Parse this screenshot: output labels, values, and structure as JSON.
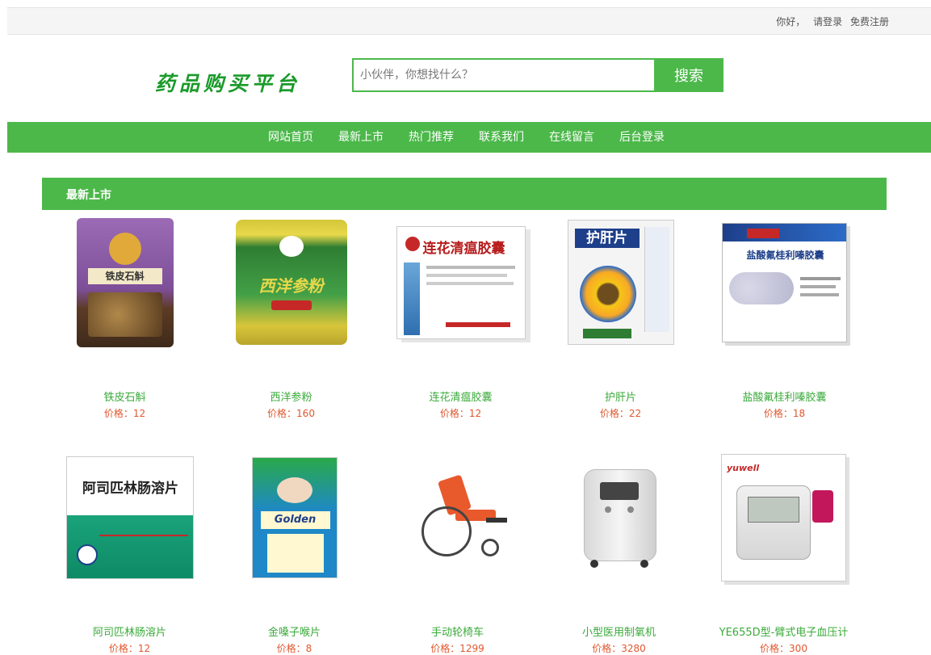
{
  "topbar": {
    "greeting": "你好，",
    "login": "请登录",
    "register": "免费注册"
  },
  "logo": {
    "text": "药品购买平台"
  },
  "search": {
    "placeholder": "小伙伴，你想找什么？",
    "button": "搜索"
  },
  "nav": {
    "items": [
      {
        "label": "网站首页"
      },
      {
        "label": "最新上市"
      },
      {
        "label": "热门推荐"
      },
      {
        "label": "联系我们"
      },
      {
        "label": "在线留言"
      },
      {
        "label": "后台登录"
      }
    ]
  },
  "section": {
    "title": "最新上市"
  },
  "products": [
    {
      "name": "铁皮石斛",
      "price": "价格：12",
      "package_text": "铁皮石斛"
    },
    {
      "name": "西洋参粉",
      "price": "价格：160",
      "package_text": "西洋参粉"
    },
    {
      "name": "连花清瘟胶囊",
      "price": "价格：12",
      "package_text": "连花清瘟胶囊"
    },
    {
      "name": "护肝片",
      "price": "价格：22",
      "package_text": "护肝片"
    },
    {
      "name": "盐酸氟桂利嗪胶囊",
      "price": "价格：18",
      "package_text": "盐酸氟桂利嗪胶囊"
    },
    {
      "name": "阿司匹林肠溶片",
      "price": "价格：12",
      "package_text": "阿司匹林肠溶片"
    },
    {
      "name": "金嗓子喉片",
      "price": "价格：8",
      "package_text": "Golden"
    },
    {
      "name": "手动轮椅车",
      "price": "价格：1299",
      "package_text": ""
    },
    {
      "name": "小型医用制氧机",
      "price": "价格：3280",
      "package_text": ""
    },
    {
      "name": "YE655D型-臂式电子血压计",
      "price": "价格：300",
      "package_text": "yuwell"
    }
  ],
  "colors": {
    "brand_green": "#4cb84a",
    "price": "#e0572f",
    "name": "#3aaa3a"
  }
}
